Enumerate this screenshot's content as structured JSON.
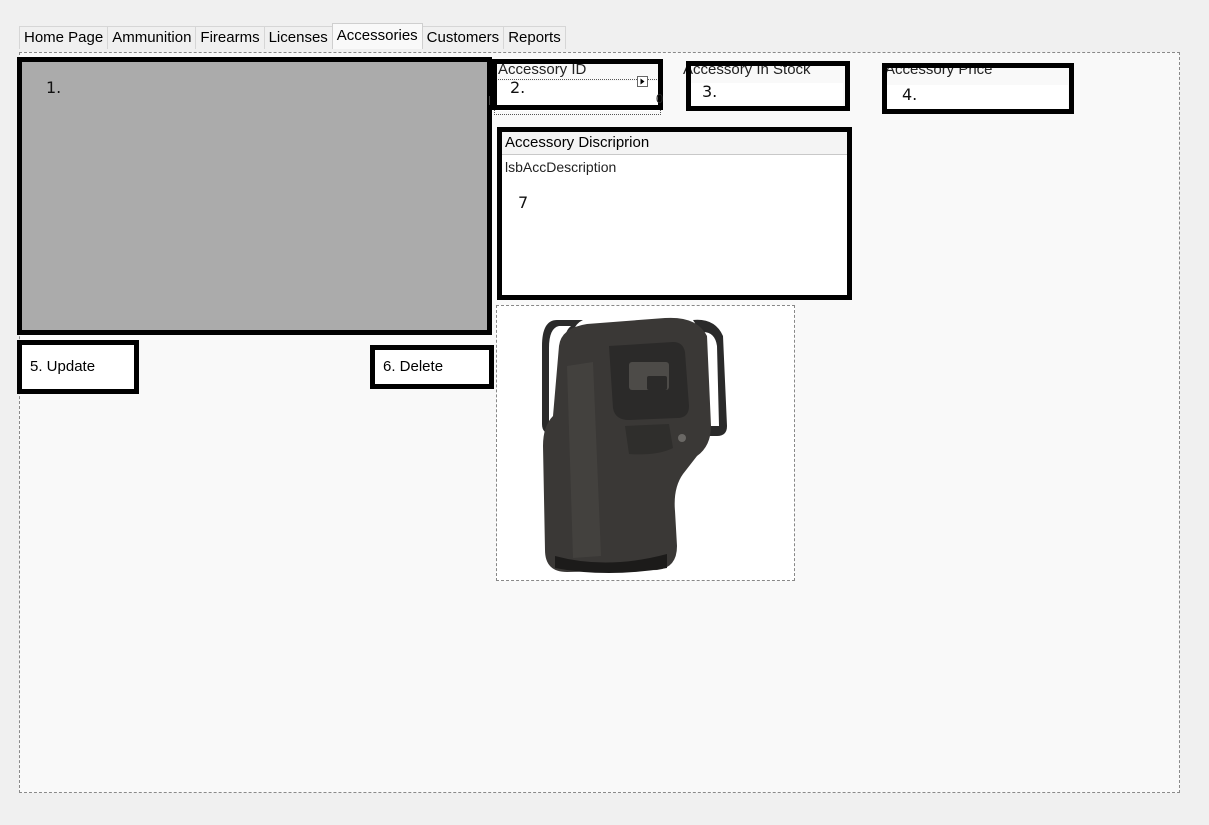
{
  "tabs": [
    {
      "label": "Home Page"
    },
    {
      "label": "Ammunition"
    },
    {
      "label": "Firearms"
    },
    {
      "label": "Licenses"
    },
    {
      "label": "Accessories",
      "active": true
    },
    {
      "label": "Customers"
    },
    {
      "label": "Reports"
    }
  ],
  "grid": {
    "marker": "1."
  },
  "accessory_id": {
    "label": "Accessory ID",
    "marker": "2.",
    "stray": "0"
  },
  "in_stock": {
    "label": "Accessory In Stock",
    "marker": "3."
  },
  "price": {
    "label": "Accessory Price",
    "marker": "4."
  },
  "description": {
    "header": "Accessory Discriprion",
    "listbox_name": "lsbAccDescription",
    "marker": "7"
  },
  "buttons": {
    "update_label": "5. Update",
    "delete_label": "6. Delete"
  },
  "image": {
    "icon": "holster-image"
  },
  "colors": {
    "background": "#f0f0f0",
    "tabpage": "#f9f9f9",
    "grid": "#ababab",
    "outline": "#000000"
  }
}
